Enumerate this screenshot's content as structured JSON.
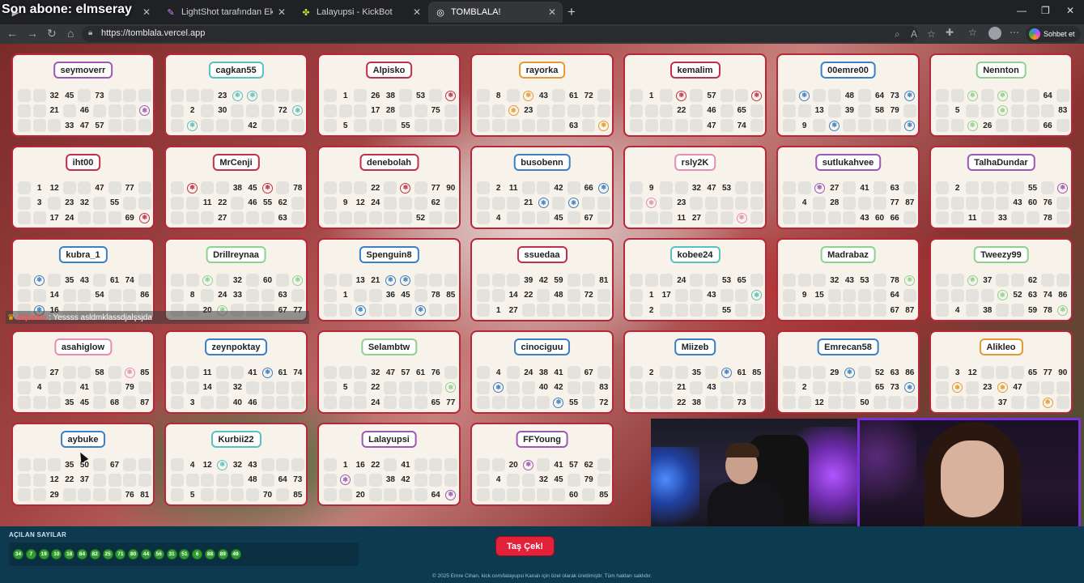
{
  "overlay_title": "Son abone: elmseray",
  "tabs": [
    {
      "label": "",
      "icon": "video-icon",
      "active": false
    },
    {
      "label": "LightShot tarafından Ekran Görünt",
      "icon": "pen-icon",
      "active": false
    },
    {
      "label": "Lalayupsi - KickBot",
      "icon": "clover-icon",
      "active": false
    },
    {
      "label": "TOMBLALA!",
      "icon": "globe-icon",
      "active": true
    }
  ],
  "address_bar": {
    "url": "https://tomblala.vercel.app"
  },
  "copilot": {
    "label": "Sohbet et"
  },
  "cards": [
    {
      "name": "seymoverr",
      "border": "#9b59b6",
      "rows": [
        [
          "",
          "",
          "32",
          "45",
          "",
          "73",
          "",
          "",
          ""
        ],
        [
          "",
          "",
          "21",
          "",
          "46",
          "",
          "",
          "",
          "S:#9b59b6"
        ],
        [
          "",
          "",
          "",
          "33",
          "47",
          "57",
          "",
          "",
          ""
        ]
      ]
    },
    {
      "name": "cagkan55",
      "border": "#5bc0c0",
      "rows": [
        [
          "",
          "",
          "",
          "23",
          "S:#5bc0c0",
          "S:#5bc0c0",
          "",
          "",
          ""
        ],
        [
          "",
          "2",
          "",
          "30",
          "",
          "",
          "",
          "72",
          "S:#5bc0c0"
        ],
        [
          "",
          "S:#5bc0c0",
          "",
          "",
          "",
          "42",
          "",
          "",
          ""
        ]
      ]
    },
    {
      "name": "Alpisko",
      "border": "#c0304a",
      "rows": [
        [
          "",
          "1",
          "",
          "26",
          "38",
          "",
          "53",
          "",
          "S:#c0304a"
        ],
        [
          "",
          "",
          "",
          "17",
          "28",
          "",
          "",
          "75",
          ""
        ],
        [
          "",
          "5",
          "",
          "",
          "",
          "55",
          "",
          "",
          ""
        ]
      ]
    },
    {
      "name": "rayorka",
      "border": "#e69a2e",
      "rows": [
        [
          "",
          "8",
          "",
          "S:#e69a2e",
          "43",
          "",
          "61",
          "72",
          ""
        ],
        [
          "",
          "",
          "S:#e69a2e",
          "23",
          "",
          "",
          "",
          "",
          ""
        ],
        [
          "",
          "",
          "",
          "",
          "",
          "",
          "63",
          "",
          "S:#e69a2e"
        ]
      ]
    },
    {
      "name": "kemalim",
      "border": "#c0304a",
      "rows": [
        [
          "",
          "1",
          "",
          "S:#c0304a",
          "",
          "57",
          "",
          "",
          "S:#c0304a"
        ],
        [
          "",
          "",
          "",
          "22",
          "",
          "46",
          "",
          "65",
          ""
        ],
        [
          "",
          "",
          "",
          "",
          "",
          "47",
          "",
          "74",
          ""
        ]
      ]
    },
    {
      "name": "00emre00",
      "border": "#3b7fc4",
      "rows": [
        [
          "",
          "S:#3b7fc4",
          "",
          "",
          "48",
          "",
          "64",
          "73",
          "S:#3b7fc4"
        ],
        [
          "",
          "",
          "13",
          "",
          "39",
          "",
          "58",
          "79",
          ""
        ],
        [
          "",
          "9",
          "",
          "S:#3b7fc4",
          "",
          "",
          "",
          "",
          "S:#3b7fc4"
        ]
      ]
    },
    {
      "name": "Nennton",
      "border": "#8fd18f",
      "rows": [
        [
          "",
          "",
          "S:#8fd18f",
          "",
          "S:#8fd18f",
          "",
          "",
          "64",
          ""
        ],
        [
          "",
          "5",
          "",
          "",
          "S:#8fd18f",
          "",
          "",
          "",
          "83"
        ],
        [
          "",
          "",
          "S:#8fd18f",
          "26",
          "",
          "",
          "",
          "66",
          ""
        ]
      ]
    },
    {
      "name": "iht00",
      "border": "#c0304a",
      "rows": [
        [
          "",
          "1",
          "12",
          "",
          "",
          "47",
          "",
          "77",
          ""
        ],
        [
          "",
          "3",
          "",
          "23",
          "32",
          "",
          "55",
          "",
          ""
        ],
        [
          "",
          "",
          "17",
          "24",
          "",
          "",
          "",
          "69",
          "S:#c0304a"
        ]
      ]
    },
    {
      "name": "MrCenji",
      "border": "#c0304a",
      "rows": [
        [
          "",
          "S:#c0304a",
          "",
          "",
          "38",
          "45",
          "S:#c0304a",
          "",
          "78"
        ],
        [
          "",
          "",
          "11",
          "22",
          "",
          "46",
          "55",
          "62",
          ""
        ],
        [
          "",
          "",
          "",
          "27",
          "",
          "",
          "",
          "63",
          ""
        ]
      ]
    },
    {
      "name": "denebolah",
      "border": "#c0304a",
      "rows": [
        [
          "",
          "",
          "",
          "22",
          "",
          "S:#c0304a",
          "",
          "77",
          "90"
        ],
        [
          "",
          "9",
          "12",
          "24",
          "",
          "",
          "",
          "62",
          ""
        ],
        [
          "",
          "",
          "",
          "",
          "",
          "",
          "52",
          "",
          ""
        ]
      ]
    },
    {
      "name": "busobenn",
      "border": "#3b7fc4",
      "rows": [
        [
          "",
          "2",
          "11",
          "",
          "",
          "42",
          "",
          "66",
          "S:#3b7fc4"
        ],
        [
          "",
          "",
          "",
          "21",
          "S:#3b7fc4",
          "",
          "S:#3b7fc4",
          "",
          ""
        ],
        [
          "",
          "4",
          "",
          "",
          "",
          "45",
          "",
          "67",
          ""
        ]
      ]
    },
    {
      "name": "rsly2K",
      "border": "#e48fb0",
      "rows": [
        [
          "",
          "9",
          "",
          "",
          "32",
          "47",
          "53",
          "",
          ""
        ],
        [
          "",
          "S:#e48fb0",
          "",
          "23",
          "",
          "",
          "",
          "",
          ""
        ],
        [
          "",
          "",
          "",
          "11",
          "27",
          "",
          "",
          "S:#e48fb0",
          ""
        ]
      ]
    },
    {
      "name": "sutlukahvee",
      "border": "#9b59b6",
      "rows": [
        [
          "",
          "",
          "S:#9b59b6",
          "27",
          "",
          "41",
          "",
          "63",
          ""
        ],
        [
          "",
          "4",
          "",
          "28",
          "",
          "",
          "",
          "77",
          "87"
        ],
        [
          "",
          "",
          "",
          "",
          "",
          "43",
          "60",
          "66",
          ""
        ]
      ]
    },
    {
      "name": "TalhaDundar",
      "border": "#9b59b6",
      "rows": [
        [
          "",
          "2",
          "",
          "",
          "",
          "",
          "55",
          "",
          "S:#9b59b6"
        ],
        [
          "",
          "",
          "",
          "",
          "",
          "43",
          "60",
          "76",
          ""
        ],
        [
          "",
          "",
          "11",
          "",
          "33",
          "",
          "",
          "78",
          ""
        ]
      ]
    },
    {
      "name": "kubra_1",
      "border": "#3b7fc4",
      "rows": [
        [
          "",
          "S:#3b7fc4",
          "",
          "35",
          "43",
          "",
          "61",
          "74",
          ""
        ],
        [
          "",
          "",
          "14",
          "",
          "",
          "54",
          "",
          "",
          "86"
        ],
        [
          "",
          "S:#3b7fc4",
          "16",
          "",
          "",
          "",
          "",
          "",
          ""
        ]
      ]
    },
    {
      "name": "Drillreynaa",
      "border": "#8fd18f",
      "rows": [
        [
          "",
          "",
          "S:#8fd18f",
          "",
          "32",
          "",
          "60",
          "",
          "S:#8fd18f"
        ],
        [
          "",
          "8",
          "",
          "24",
          "33",
          "",
          "",
          "63",
          ""
        ],
        [
          "",
          "",
          "20",
          "S:#8fd18f",
          "",
          "",
          "",
          "67",
          "77"
        ]
      ]
    },
    {
      "name": "Spenguin8",
      "border": "#3b7fc4",
      "rows": [
        [
          "",
          "",
          "13",
          "21",
          "S:#3b7fc4",
          "S:#3b7fc4",
          "",
          "",
          ""
        ],
        [
          "",
          "1",
          "",
          "",
          "36",
          "45",
          "",
          "78",
          "85"
        ],
        [
          "",
          "",
          "S:#3b7fc4",
          "",
          "",
          "",
          "S:#3b7fc4",
          "",
          ""
        ]
      ]
    },
    {
      "name": "ssuedaa",
      "border": "#c0304a",
      "rows": [
        [
          "",
          "",
          "",
          "39",
          "42",
          "59",
          "",
          "",
          "81"
        ],
        [
          "",
          "",
          "14",
          "22",
          "",
          "48",
          "",
          "72",
          ""
        ],
        [
          "",
          "1",
          "27",
          "",
          "",
          "",
          "",
          "",
          ""
        ]
      ]
    },
    {
      "name": "kobee24",
      "border": "#5bc0c0",
      "rows": [
        [
          "",
          "",
          "",
          "24",
          "",
          "",
          "53",
          "65",
          ""
        ],
        [
          "",
          "1",
          "17",
          "",
          "",
          "43",
          "",
          "",
          "S:#5bc0c0"
        ],
        [
          "",
          "2",
          "",
          "",
          "",
          "",
          "55",
          "",
          ""
        ]
      ]
    },
    {
      "name": "Madrabaz",
      "border": "#8fd18f",
      "rows": [
        [
          "",
          "",
          "",
          "32",
          "43",
          "53",
          "",
          "78",
          "S:#8fd18f"
        ],
        [
          "",
          "9",
          "15",
          "",
          "",
          "",
          "",
          "64",
          ""
        ],
        [
          "",
          "",
          "",
          "",
          "",
          "",
          "",
          "67",
          "87"
        ]
      ]
    },
    {
      "name": "Tweezy99",
      "border": "#8fd18f",
      "rows": [
        [
          "",
          "",
          "S:#8fd18f",
          "37",
          "",
          "",
          "62",
          "",
          ""
        ],
        [
          "",
          "",
          "",
          "",
          "S:#8fd18f",
          "52",
          "63",
          "74",
          "86"
        ],
        [
          "",
          "4",
          "",
          "38",
          "",
          "",
          "59",
          "78",
          "S:#8fd18f"
        ]
      ]
    },
    {
      "name": "asahiglow",
      "border": "#e48fb0",
      "rows": [
        [
          "",
          "",
          "27",
          "",
          "",
          "58",
          "",
          "S:#e48fb0",
          "85"
        ],
        [
          "",
          "4",
          "",
          "",
          "41",
          "",
          "",
          "79",
          ""
        ],
        [
          "",
          "",
          "",
          "35",
          "45",
          "",
          "68",
          "",
          "87"
        ]
      ]
    },
    {
      "name": "zeynpoktay",
      "border": "#3b7fc4",
      "rows": [
        [
          "",
          "",
          "11",
          "",
          "",
          "41",
          "S:#3b7fc4",
          "61",
          "74"
        ],
        [
          "",
          "",
          "14",
          "",
          "32",
          "",
          "",
          "",
          ""
        ],
        [
          "",
          "3",
          "",
          "",
          "40",
          "46",
          "",
          "",
          ""
        ]
      ]
    },
    {
      "name": "Selambtw",
      "border": "#8fd18f",
      "rows": [
        [
          "",
          "",
          "",
          "32",
          "47",
          "57",
          "61",
          "76",
          ""
        ],
        [
          "",
          "5",
          "",
          "22",
          "",
          "",
          "",
          "",
          "S:#8fd18f"
        ],
        [
          "",
          "",
          "",
          "24",
          "",
          "",
          "",
          "65",
          "77"
        ]
      ]
    },
    {
      "name": "cinociguu",
      "border": "#3b7fc4",
      "rows": [
        [
          "",
          "4",
          "",
          "24",
          "38",
          "41",
          "",
          "67",
          ""
        ],
        [
          "",
          "S:#3b7fc4",
          "",
          "",
          "40",
          "42",
          "",
          "",
          "83"
        ],
        [
          "",
          "",
          "",
          "",
          "",
          "S:#3b7fc4",
          "55",
          "",
          "72"
        ]
      ]
    },
    {
      "name": "Miizeb",
      "border": "#3b7fc4",
      "rows": [
        [
          "",
          "2",
          "",
          "",
          "35",
          "",
          "S:#3b7fc4",
          "61",
          "85"
        ],
        [
          "",
          "",
          "",
          "21",
          "",
          "43",
          "",
          "",
          ""
        ],
        [
          "",
          "",
          "",
          "22",
          "38",
          "",
          "",
          "73",
          ""
        ]
      ]
    },
    {
      "name": "Emrecan58",
      "border": "#3b7fc4",
      "rows": [
        [
          "",
          "",
          "",
          "29",
          "S:#3b7fc4",
          "",
          "52",
          "63",
          "86"
        ],
        [
          "",
          "2",
          "",
          "",
          "",
          "",
          "65",
          "73",
          "S:#3b7fc4"
        ],
        [
          "",
          "",
          "12",
          "",
          "",
          "50",
          "",
          "",
          ""
        ]
      ]
    },
    {
      "name": "Alikleo",
      "border": "#e69a2e",
      "rows": [
        [
          "",
          "3",
          "12",
          "",
          "",
          "",
          "65",
          "77",
          "90"
        ],
        [
          "",
          "S:#e69a2e",
          "",
          "23",
          "S:#e69a2e",
          "47",
          "",
          "",
          ""
        ],
        [
          "",
          "",
          "",
          "",
          "37",
          "",
          "",
          "S:#e69a2e",
          ""
        ]
      ]
    },
    {
      "name": "aybuke",
      "border": "#3b7fc4",
      "rows": [
        [
          "",
          "",
          "",
          "35",
          "50",
          "",
          "67",
          "",
          ""
        ],
        [
          "",
          "",
          "12",
          "22",
          "37",
          "",
          "",
          "",
          ""
        ],
        [
          "",
          "",
          "29",
          "",
          "",
          "",
          "",
          "76",
          "81"
        ]
      ]
    },
    {
      "name": "Kurbii22",
      "border": "#5bc0c0",
      "rows": [
        [
          "",
          "4",
          "12",
          "S:#5bc0c0",
          "32",
          "43",
          "",
          "",
          ""
        ],
        [
          "",
          "",
          "",
          "",
          "",
          "48",
          "",
          "64",
          "73",
          "S:#5bc0c0"
        ],
        [
          "",
          "5",
          "",
          "",
          "",
          "",
          "70",
          "",
          "85"
        ]
      ]
    },
    {
      "name": "Lalayupsi",
      "border": "#9b59b6",
      "rows": [
        [
          "",
          "1",
          "16",
          "22",
          "",
          "41",
          "",
          "",
          ""
        ],
        [
          "",
          "S:#9b59b6",
          "",
          "",
          "38",
          "42",
          "",
          "",
          ""
        ],
        [
          "",
          "",
          "20",
          "",
          "",
          "",
          "",
          "64",
          "S:#9b59b6"
        ]
      ]
    },
    {
      "name": "FFYoung",
      "border": "#9b59b6",
      "rows": [
        [
          "",
          "",
          "20",
          "S:#9b59b6",
          "",
          "41",
          "57",
          "62",
          ""
        ],
        [
          "",
          "4",
          "",
          "",
          "32",
          "45",
          "",
          "79",
          ""
        ],
        [
          "",
          "",
          "",
          "",
          "",
          "",
          "60",
          "",
          "85"
        ]
      ]
    }
  ],
  "chat": {
    "user": "Alpisko",
    "message": ": Yessss asldmklassdjalşsjda"
  },
  "drawn_label": "AÇILAN SAYILAR",
  "drawn_numbers": [
    "34",
    "7",
    "19",
    "10",
    "18",
    "84",
    "82",
    "25",
    "71",
    "80",
    "44",
    "56",
    "31",
    "51",
    "6",
    "88",
    "89",
    "49"
  ],
  "draw_button": "Taş Çek!",
  "footer": "© 2025 Emre Cihan. kick.com/lalayupsi Kanalı için özel olarak üretilmiştir. Tüm hakları saklıdır.",
  "colors": {
    "card_border": "#b8263a",
    "ball": "#2f9e2f",
    "draw_button": "#e3213a",
    "bottom_bar": "#0d3a4f"
  }
}
